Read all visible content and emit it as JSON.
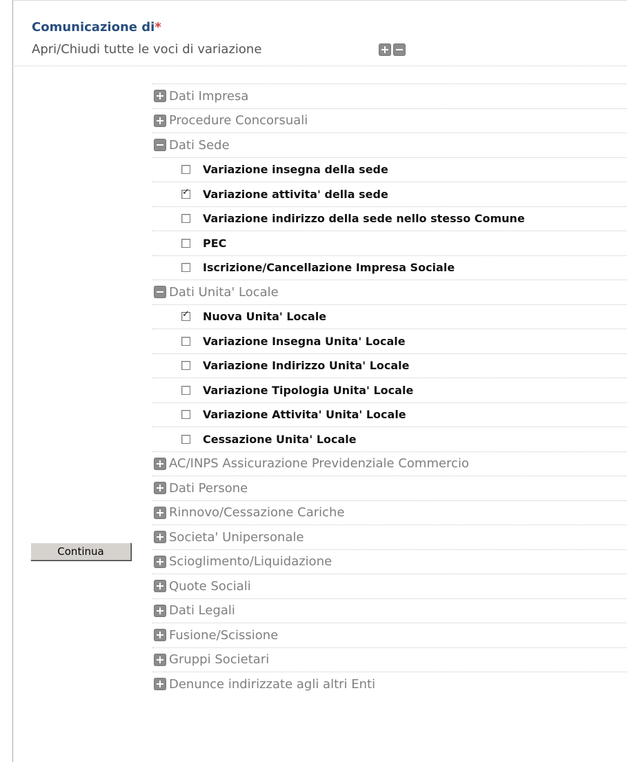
{
  "header": {
    "title": "Comunicazione di",
    "required_mark": "*",
    "toggle_all_label": "Apri/Chiudi tutte le voci di variazione"
  },
  "sections": [
    {
      "label": "Dati Impresa",
      "expanded": false,
      "items": []
    },
    {
      "label": "Procedure Concorsuali",
      "expanded": false,
      "items": []
    },
    {
      "label": "Dati Sede",
      "expanded": true,
      "items": [
        {
          "label": "Variazione insegna della sede",
          "checked": false
        },
        {
          "label": "Variazione attivita' della sede",
          "checked": true
        },
        {
          "label": "Variazione indirizzo della sede nello stesso Comune",
          "checked": false
        },
        {
          "label": "PEC",
          "checked": false
        },
        {
          "label": "Iscrizione/Cancellazione Impresa Sociale",
          "checked": false
        }
      ]
    },
    {
      "label": "Dati Unita' Locale",
      "expanded": true,
      "items": [
        {
          "label": "Nuova Unita' Locale",
          "checked": true
        },
        {
          "label": "Variazione Insegna Unita' Locale",
          "checked": false
        },
        {
          "label": "Variazione Indirizzo Unita' Locale",
          "checked": false
        },
        {
          "label": "Variazione Tipologia Unita' Locale",
          "checked": false
        },
        {
          "label": "Variazione Attivita' Unita' Locale",
          "checked": false
        },
        {
          "label": "Cessazione Unita' Locale",
          "checked": false
        }
      ]
    },
    {
      "label": "AC/INPS Assicurazione Previdenziale Commercio",
      "expanded": false,
      "items": []
    },
    {
      "label": "Dati Persone",
      "expanded": false,
      "items": []
    },
    {
      "label": "Rinnovo/Cessazione Cariche",
      "expanded": false,
      "items": []
    },
    {
      "label": "Societa' Unipersonale",
      "expanded": false,
      "items": []
    },
    {
      "label": "Scioglimento/Liquidazione",
      "expanded": false,
      "items": []
    },
    {
      "label": "Quote Sociali",
      "expanded": false,
      "items": []
    },
    {
      "label": "Dati Legali",
      "expanded": false,
      "items": []
    },
    {
      "label": "Fusione/Scissione",
      "expanded": false,
      "items": []
    },
    {
      "label": "Gruppi Societari",
      "expanded": false,
      "items": []
    },
    {
      "label": "Denunce indirizzate agli altri Enti",
      "expanded": false,
      "items": []
    }
  ],
  "footer": {
    "continue_label": "Continua"
  },
  "icons": {
    "expand": "plus-icon",
    "collapse": "minus-icon"
  },
  "colors": {
    "title": "#274e7e",
    "required": "#d23c3c",
    "section_label": "#7f7f7f",
    "icon_gray": "#8c8c8c"
  }
}
